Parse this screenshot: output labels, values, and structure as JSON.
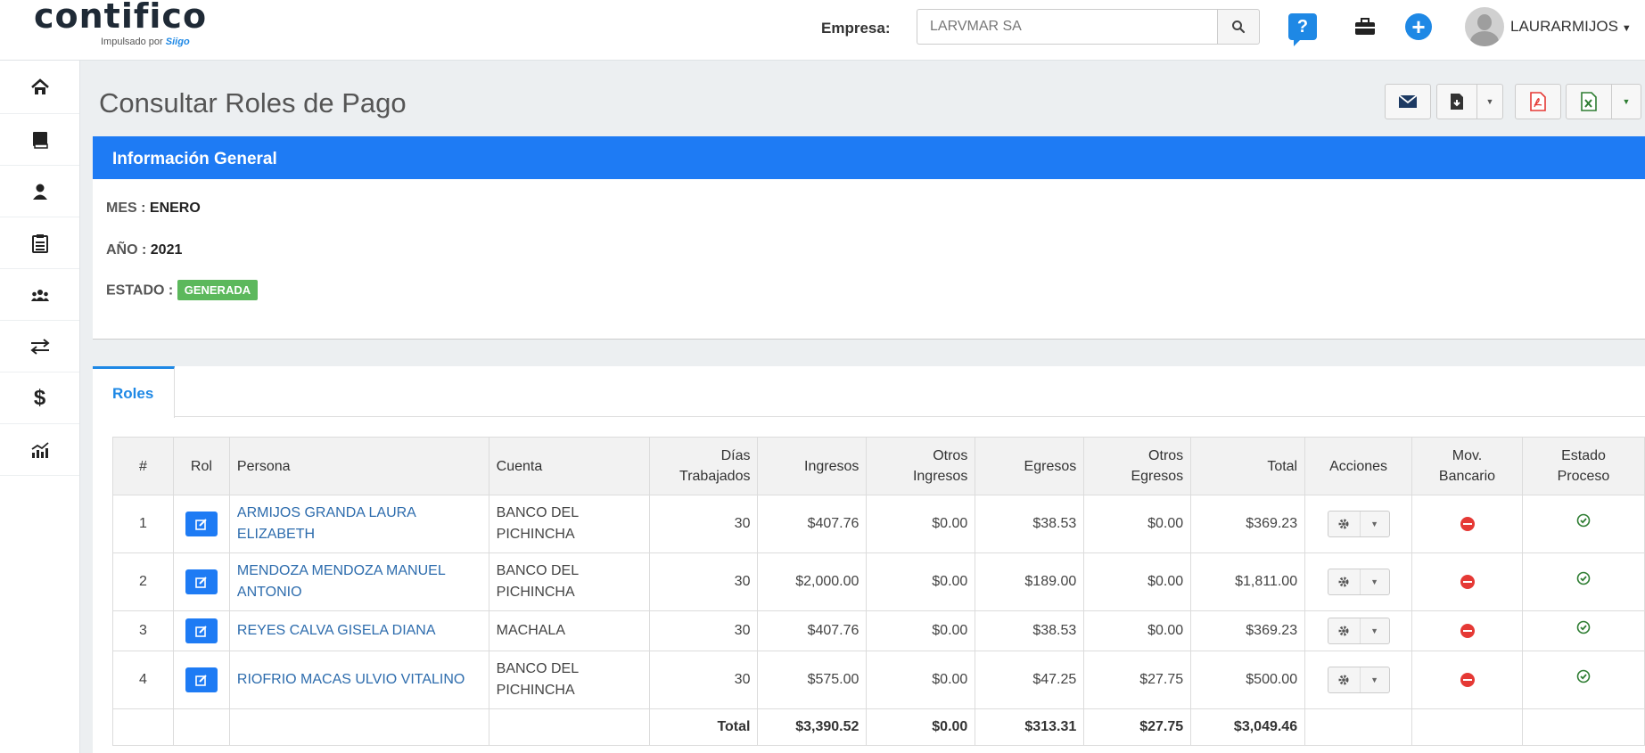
{
  "header": {
    "logo_main": "contifico",
    "logo_sub_prefix": "Impulsado por",
    "logo_sub_brand": "Siigo",
    "empresa_label": "Empresa:",
    "empresa_value": "LARVMAR SA",
    "user_name": "LAURARMIJOS"
  },
  "sidebar": {
    "items": [
      "home-icon",
      "book-icon",
      "user-icon",
      "clipboard-icon",
      "users-icon",
      "exchange-icon",
      "dollar-icon",
      "chart-icon"
    ]
  },
  "page": {
    "title": "Consultar Roles de Pago"
  },
  "info": {
    "panel_title": "Información General",
    "mes_label": "MES :",
    "mes_value": "ENERO",
    "anio_label": "AÑO :",
    "anio_value": "2021",
    "estado_label": "ESTADO :",
    "estado_value": "GENERADA"
  },
  "roles": {
    "tab_label": "Roles",
    "columns": {
      "num": "#",
      "rol": "Rol",
      "persona": "Persona",
      "cuenta": "Cuenta",
      "dias_1": "Días",
      "dias_2": "Trabajados",
      "ingresos": "Ingresos",
      "otros_ing_1": "Otros",
      "otros_ing_2": "Ingresos",
      "egresos": "Egresos",
      "otros_egr_1": "Otros",
      "otros_egr_2": "Egresos",
      "total": "Total",
      "acciones": "Acciones",
      "mov_1": "Mov.",
      "mov_2": "Bancario",
      "estado_1": "Estado",
      "estado_2": "Proceso"
    },
    "rows": [
      {
        "num": "1",
        "persona": "ARMIJOS GRANDA LAURA ELIZABETH",
        "cuenta": "BANCO DEL PICHINCHA",
        "dias": "30",
        "ingresos": "$407.76",
        "otros_ingresos": "$0.00",
        "egresos": "$38.53",
        "otros_egresos": "$0.00",
        "total": "$369.23"
      },
      {
        "num": "2",
        "persona": "MENDOZA MENDOZA MANUEL ANTONIO",
        "cuenta": "BANCO DEL PICHINCHA",
        "dias": "30",
        "ingresos": "$2,000.00",
        "otros_ingresos": "$0.00",
        "egresos": "$189.00",
        "otros_egresos": "$0.00",
        "total": "$1,811.00"
      },
      {
        "num": "3",
        "persona": "REYES CALVA GISELA DIANA",
        "cuenta": "MACHALA",
        "dias": "30",
        "ingresos": "$407.76",
        "otros_ingresos": "$0.00",
        "egresos": "$38.53",
        "otros_egresos": "$0.00",
        "total": "$369.23"
      },
      {
        "num": "4",
        "persona": "RIOFRIO MACAS ULVIO VITALINO",
        "cuenta": "BANCO DEL PICHINCHA",
        "dias": "30",
        "ingresos": "$575.00",
        "otros_ingresos": "$0.00",
        "egresos": "$47.25",
        "otros_egresos": "$27.75",
        "total": "$500.00"
      }
    ],
    "totals": {
      "label": "Total",
      "ingresos": "$3,390.52",
      "otros_ingresos": "$0.00",
      "egresos": "$313.31",
      "otros_egresos": "$27.75",
      "total": "$3,049.46"
    }
  },
  "colors": {
    "primary": "#1e7bf4",
    "success": "#5cb85c",
    "danger": "#e53935",
    "link": "#2d6cad"
  }
}
